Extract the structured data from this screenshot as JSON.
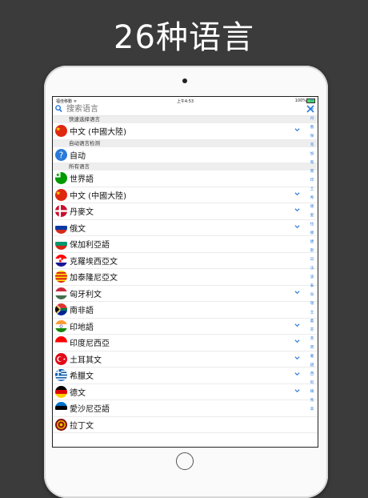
{
  "headline": "26种语言",
  "status": {
    "carrier": "福佳移動 ᯤ",
    "time": "上午4:53",
    "battery": "100%"
  },
  "search": {
    "placeholder": "搜索语言"
  },
  "sections": {
    "quick": "快速选择语言",
    "auto": "自动语言检测",
    "all": "所有语言"
  },
  "quick_items": [
    {
      "label": "中文 (中國大陸)",
      "flag": "flag-china-icon",
      "chevron": true
    }
  ],
  "auto_items": [
    {
      "label": "自动",
      "flag": "question-icon",
      "chevron": false
    }
  ],
  "all_items": [
    {
      "label": "世界語",
      "flag": "flag-esperanto-icon",
      "chevron": false
    },
    {
      "label": "中文 (中國大陸)",
      "flag": "flag-china-icon",
      "chevron": true
    },
    {
      "label": "丹麥文",
      "flag": "flag-denmark-icon",
      "chevron": true
    },
    {
      "label": "俄文",
      "flag": "flag-russia-icon",
      "chevron": true
    },
    {
      "label": "保加利亞語",
      "flag": "flag-bulgaria-icon",
      "chevron": false
    },
    {
      "label": "克羅埃西亞文",
      "flag": "flag-croatia-icon",
      "chevron": false
    },
    {
      "label": "加泰隆尼亞文",
      "flag": "flag-catalonia-icon",
      "chevron": false
    },
    {
      "label": "匈牙利文",
      "flag": "flag-hungary-icon",
      "chevron": true
    },
    {
      "label": "南非語",
      "flag": "flag-south-africa-icon",
      "chevron": false
    },
    {
      "label": "印地語",
      "flag": "flag-india-icon",
      "chevron": true
    },
    {
      "label": "印度尼西亞",
      "flag": "flag-indonesia-icon",
      "chevron": true
    },
    {
      "label": "土耳其文",
      "flag": "flag-turkey-icon",
      "chevron": true
    },
    {
      "label": "希臘文",
      "flag": "flag-greece-icon",
      "chevron": true
    },
    {
      "label": "德文",
      "flag": "flag-germany-icon",
      "chevron": true
    },
    {
      "label": "愛沙尼亞語",
      "flag": "flag-estonia-icon",
      "chevron": false
    },
    {
      "label": "拉丁文",
      "flag": "flag-latin-icon",
      "chevron": false
    }
  ],
  "index_letters": [
    "世",
    "中",
    "丹",
    "俄",
    "保",
    "克",
    "加",
    "匈",
    "南",
    "印",
    "土",
    "希",
    "德",
    "愛",
    "拉",
    "挪",
    "捷",
    "斯",
    "日",
    "法",
    "波",
    "泰",
    "烏",
    "瑞",
    "立",
    "義",
    "芬",
    "英",
    "荷",
    "葡",
    "越",
    "西",
    "阿",
    "韓",
    "馬",
    "高"
  ],
  "colors": {
    "accent": "#2a7bd9"
  }
}
